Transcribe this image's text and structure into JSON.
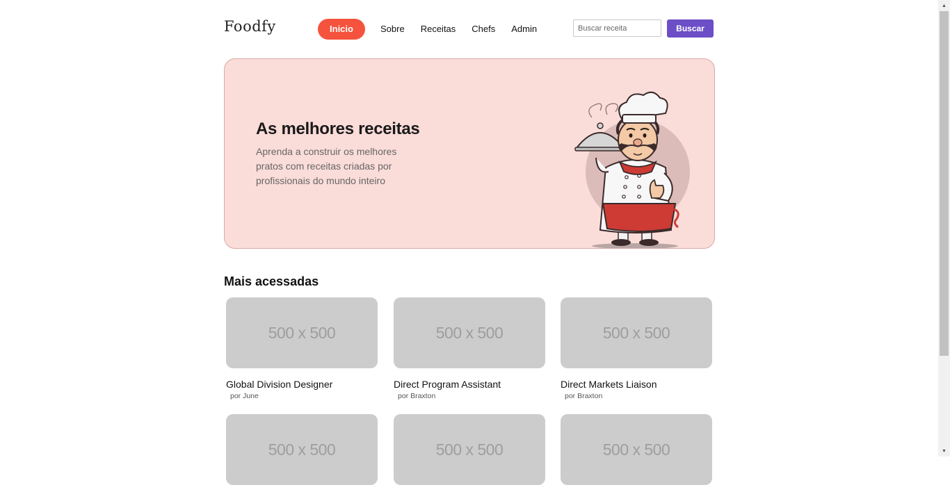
{
  "header": {
    "logo": "Foodfy",
    "nav": [
      "Inicio",
      "Sobre",
      "Receitas",
      "Chefs",
      "Admin"
    ],
    "search_placeholder": "Buscar receita",
    "search_button": "Buscar"
  },
  "hero": {
    "title": "As melhores receitas",
    "text": "Aprenda a construir os melhores pratos com receitas criadas por profissionais do mundo inteiro"
  },
  "section": {
    "title": "Mais acessadas",
    "cards": [
      {
        "image_text": "500 x 500",
        "title": "Global Division Designer",
        "author": "por June"
      },
      {
        "image_text": "500 x 500",
        "title": "Direct Program Assistant",
        "author": "por Braxton"
      },
      {
        "image_text": "500 x 500",
        "title": "Direct Markets Liaison",
        "author": "por Braxton"
      },
      {
        "image_text": "500 x 500",
        "title": "",
        "author": ""
      },
      {
        "image_text": "500 x 500",
        "title": "",
        "author": ""
      },
      {
        "image_text": "500 x 500",
        "title": "",
        "author": ""
      }
    ]
  },
  "colors": {
    "accent": "#f5533d",
    "button": "#6c4ec7",
    "hero_bg": "#fadcd9",
    "placeholder": "#cccccc"
  },
  "icons": [
    "chef-illustration",
    "scroll-up-arrow-icon",
    "scroll-down-arrow-icon"
  ]
}
